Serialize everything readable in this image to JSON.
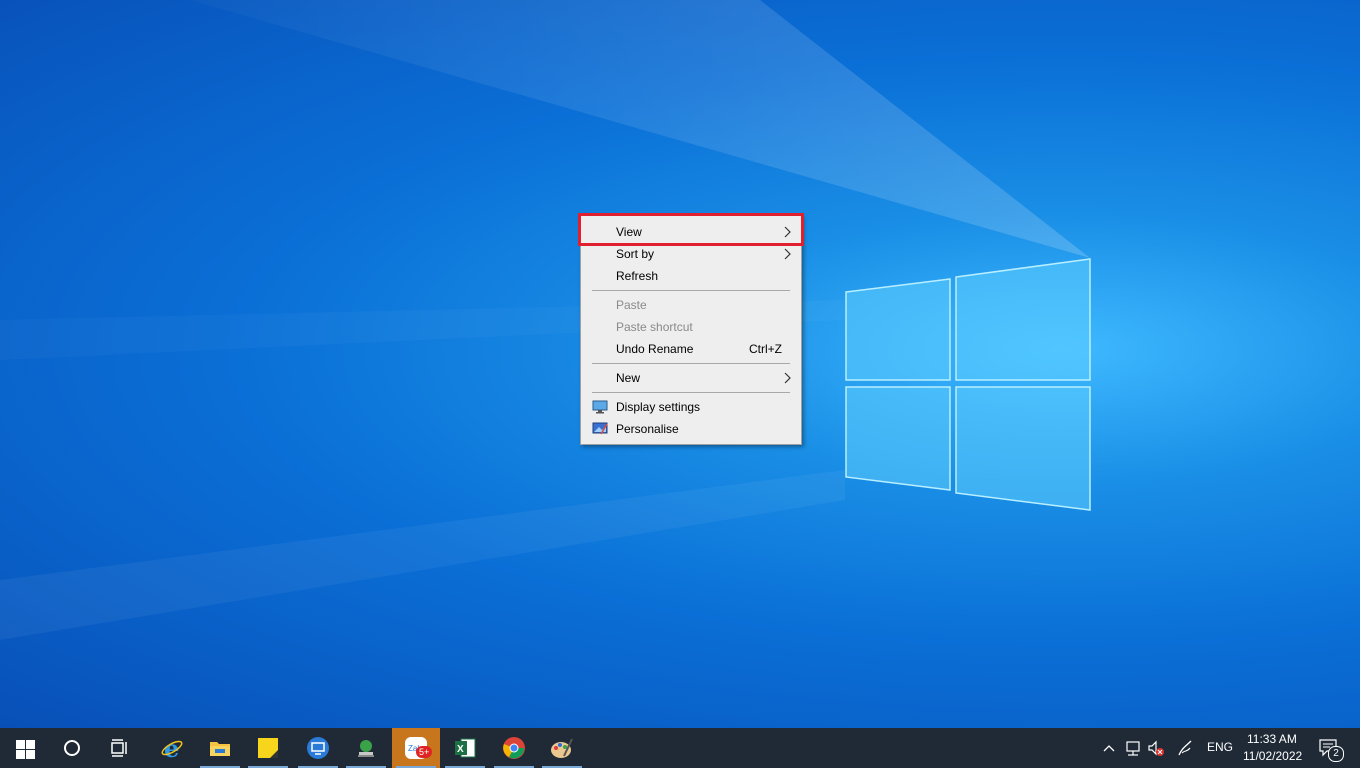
{
  "context_menu": {
    "items": [
      {
        "label": "View",
        "submenu": true,
        "highlighted": true
      },
      {
        "label": "Sort by",
        "submenu": true
      },
      {
        "label": "Refresh"
      },
      {
        "label": "Paste",
        "disabled": true
      },
      {
        "label": "Paste shortcut",
        "disabled": true
      },
      {
        "label": "Undo Rename",
        "shortcut": "Ctrl+Z"
      },
      {
        "label": "New",
        "submenu": true
      },
      {
        "label": "Display settings",
        "icon": "display-settings-icon"
      },
      {
        "label": "Personalise",
        "icon": "personalise-icon"
      }
    ]
  },
  "taskbar": {
    "start_icon": "windows-start-icon",
    "search_icon": "cortana-circle-icon",
    "taskview_icon": "task-view-icon",
    "apps": [
      {
        "icon": "internet-explorer-icon"
      },
      {
        "icon": "file-explorer-icon",
        "open": true
      },
      {
        "icon": "sticky-notes-icon",
        "open": true
      },
      {
        "icon": "remote-desktop-icon",
        "open": true
      },
      {
        "icon": "network-app-icon",
        "open": true
      },
      {
        "icon": "zalo-icon",
        "badge": "5+",
        "highlighted": true
      },
      {
        "icon": "excel-icon",
        "open": true
      },
      {
        "icon": "chrome-icon",
        "open": true
      },
      {
        "icon": "paint-icon",
        "open": true
      }
    ],
    "tray": {
      "language": "ENG",
      "time": "11:33 AM",
      "date": "11/02/2022",
      "notification_count": "2"
    }
  },
  "colors": {
    "highlight_border": "#e0202e",
    "taskbar_bg": "#1f2a36",
    "active_app_bg": "#c8761e"
  }
}
